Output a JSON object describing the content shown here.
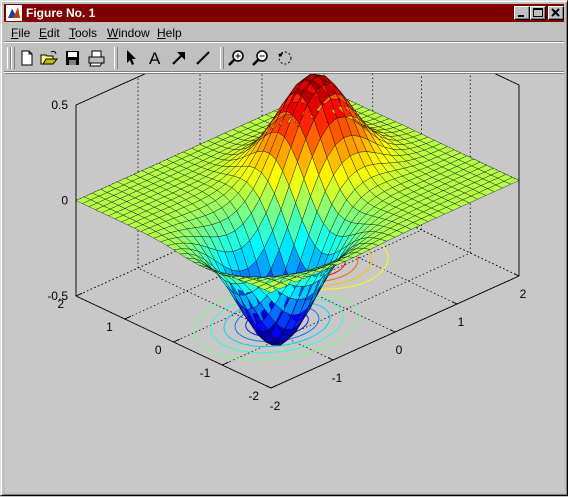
{
  "window": {
    "title": "Figure No. 1",
    "titlebar_color": "#800000"
  },
  "titlebar_buttons": [
    "minimize-icon",
    "maximize-icon",
    "close-icon"
  ],
  "menu": [
    {
      "label": "File",
      "name": "menu-file"
    },
    {
      "label": "Edit",
      "name": "menu-edit"
    },
    {
      "label": "Tools",
      "name": "menu-tools"
    },
    {
      "label": "Window",
      "name": "menu-window"
    },
    {
      "label": "Help",
      "name": "menu-help"
    }
  ],
  "toolbar": [
    "new-figure-icon",
    "open-file-icon",
    "save-icon",
    "print-icon",
    "select-arrow-icon",
    "insert-text-icon",
    "insert-arrow-icon",
    "insert-line-icon",
    "zoom-in-icon",
    "zoom-out-icon",
    "rotate-3d-icon"
  ],
  "toolbar_text": {
    "insert_text_glyph": "A"
  },
  "chart_data": {
    "type": "surface3d",
    "description_free": true,
    "title": "",
    "colormap": "jet",
    "contour_below_surface": true,
    "z_ticks": [
      "0.5",
      "0",
      "-0.5"
    ],
    "x_ticks": [
      "-2",
      "-1",
      "0",
      "1",
      "2"
    ],
    "y_ticks": [
      "-2",
      "-1",
      "0",
      "1",
      "2"
    ],
    "xlim": [
      -2,
      2
    ],
    "ylim": [
      -2,
      2
    ],
    "zlim": [
      -0.5,
      0.5
    ],
    "grid": "dotted"
  }
}
